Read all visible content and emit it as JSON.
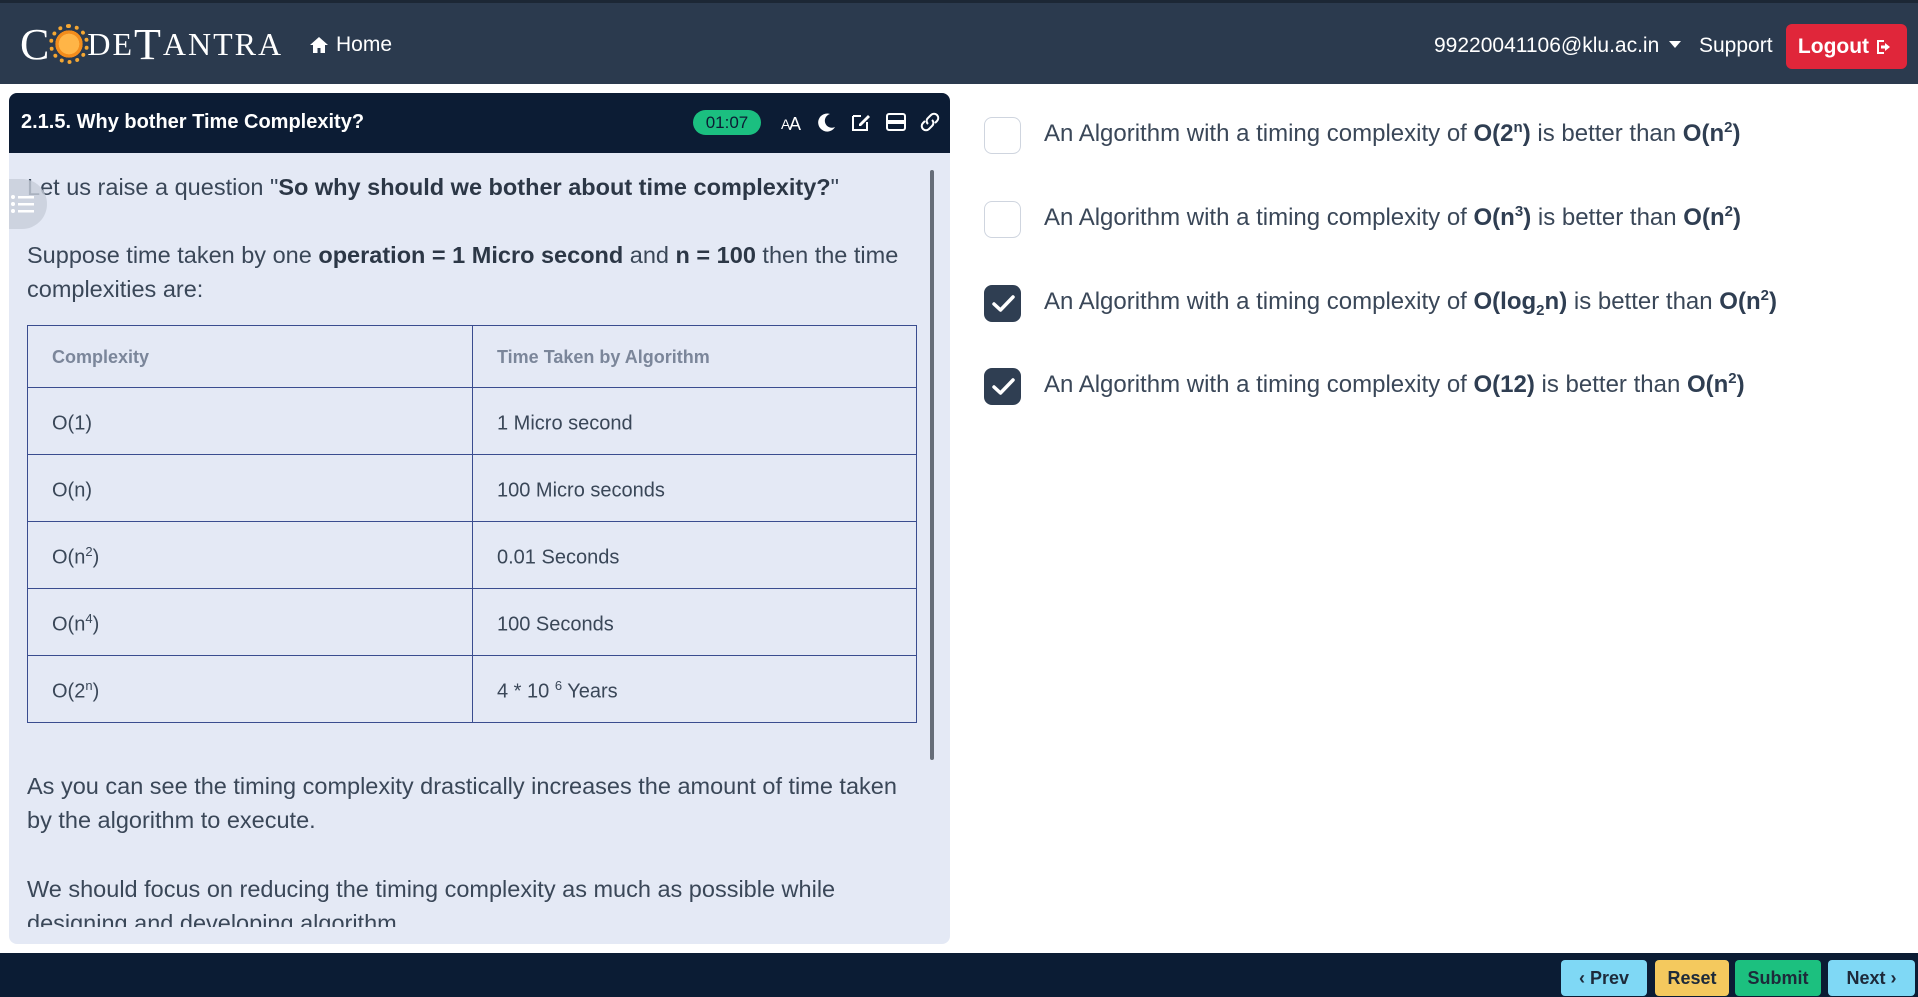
{
  "header": {
    "logo_first": "C",
    "logo_rest_1": "DE",
    "logo_T": "T",
    "logo_rest_2": "ANTRA",
    "home_label": "Home",
    "user_email": "99220041106@klu.ac.in",
    "support_label": "Support",
    "logout_label": "Logout"
  },
  "panel": {
    "title": "2.1.5. Why bother Time Complexity?",
    "timer": "01:07",
    "tools": [
      "font-size-icon",
      "dark-mode-icon",
      "edit-icon",
      "layout-icon",
      "link-icon"
    ],
    "para1_prefix": "Let us raise a question \"",
    "para1_bold": "So why should we bother about time complexity?",
    "para1_suffix": "\"",
    "para2_a": "Suppose time taken by one ",
    "para2_b": "operation = 1 Micro second",
    "para2_c": " and ",
    "para2_d": "n = 100",
    "para2_e": " then the time complexities are:",
    "table": {
      "headers": [
        "Complexity",
        "Time Taken by Algorithm"
      ],
      "rows": [
        {
          "c": "O(1)",
          "sup": "",
          "c_end": "",
          "t": "1 Micro second",
          "t_sup": "",
          "t_end": ""
        },
        {
          "c": "O(n)",
          "sup": "",
          "c_end": "",
          "t": "100 Micro seconds",
          "t_sup": "",
          "t_end": ""
        },
        {
          "c": "O(n",
          "sup": "2",
          "c_end": ")",
          "t": "0.01 Seconds",
          "t_sup": "",
          "t_end": ""
        },
        {
          "c": "O(n",
          "sup": "4",
          "c_end": ")",
          "t": "100 Seconds",
          "t_sup": "",
          "t_end": ""
        },
        {
          "c": "O(2",
          "sup": "n",
          "c_end": ")",
          "t": "4 * 10 ",
          "t_sup": "6",
          "t_end": " Years"
        }
      ]
    },
    "para3": "As you can see the timing complexity drastically increases the amount of time taken by the algorithm to execute.",
    "para4": "We should focus on reducing the timing complexity as much as possible while designing and developing algorithm."
  },
  "options": [
    {
      "checked": false,
      "prefix": "An Algorithm with a timing complexity of ",
      "a_base": "O(2",
      "a_sup": "n",
      "a_sub": "",
      "a_tail": "",
      "a_end": ")",
      "middle": " is better than ",
      "b_base": "O(n",
      "b_sup": "2",
      "b_end": ")"
    },
    {
      "checked": false,
      "prefix": "An Algorithm with a timing complexity of ",
      "a_base": "O(n",
      "a_sup": "3",
      "a_sub": "",
      "a_tail": "",
      "a_end": ")",
      "middle": " is better than ",
      "b_base": "O(n",
      "b_sup": "2",
      "b_end": ")"
    },
    {
      "checked": true,
      "prefix": "An Algorithm with a timing complexity of ",
      "a_base": "O(log",
      "a_sup": "",
      "a_sub": "2",
      "a_tail": "n",
      "a_end": ")",
      "middle": " is better than ",
      "b_base": "O(n",
      "b_sup": "2",
      "b_end": ")"
    },
    {
      "checked": true,
      "prefix": "An Algorithm with a timing complexity of ",
      "a_base": "O(12",
      "a_sup": "",
      "a_sub": "",
      "a_tail": "",
      "a_end": ")",
      "middle": " is better than ",
      "b_base": "O(n",
      "b_sup": "2",
      "b_end": ")"
    }
  ],
  "footer": {
    "prev_label": "Prev",
    "reset_label": "Reset",
    "submit_label": "Submit",
    "next_label": "Next"
  },
  "colors": {
    "header_bg": "#2b3a4e",
    "panel_head_bg": "#0c1c34",
    "panel_bg": "#e4e9f5",
    "timer_bg": "#1bbf80",
    "logout_bg": "#e0263a",
    "prev_next_bg": "#7fd8f5",
    "reset_bg": "#f4c95e",
    "submit_bg": "#1cc07f",
    "footer_bg": "#0b1c34"
  }
}
